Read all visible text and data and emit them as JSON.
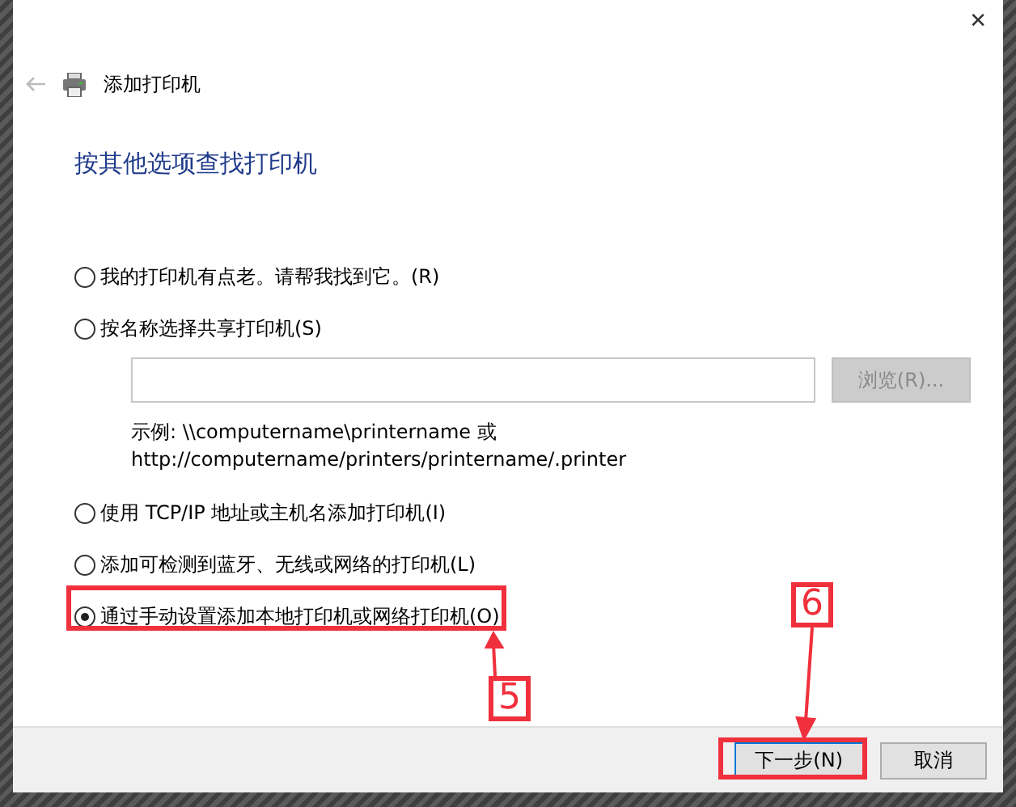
{
  "window": {
    "close_glyph": "✕",
    "title": "添加打印机"
  },
  "heading": "按其他选项查找打印机",
  "options": [
    {
      "kind": "radio",
      "label": "我的打印机有点老。请帮我找到它。(R)",
      "selected": false
    },
    {
      "kind": "radio",
      "label": "按名称选择共享打印机(S)",
      "selected": false,
      "field": {
        "kind": "text"
      },
      "browse": {
        "label": "浏览(R)...",
        "disabled": true
      },
      "example_lines": [
        "示例: \\\\computername\\printername 或",
        "http://computername/printers/printername/.printer"
      ]
    },
    {
      "kind": "radio",
      "label": "使用 TCP/IP 地址或主机名添加打印机(I)",
      "selected": false
    },
    {
      "kind": "radio",
      "label": "添加可检测到蓝牙、无线或网络的打印机(L)",
      "selected": false
    },
    {
      "kind": "radio",
      "label": "通过手动设置添加本地打印机或网络打印机(O)",
      "selected": true
    }
  ],
  "buttons": [
    {
      "label": "下一步(N)",
      "default": true
    },
    {
      "label": "取消",
      "default": false
    }
  ],
  "annotations": [
    {
      "label": "5",
      "kind": "option"
    },
    {
      "label": "6",
      "kind": "button"
    }
  ]
}
